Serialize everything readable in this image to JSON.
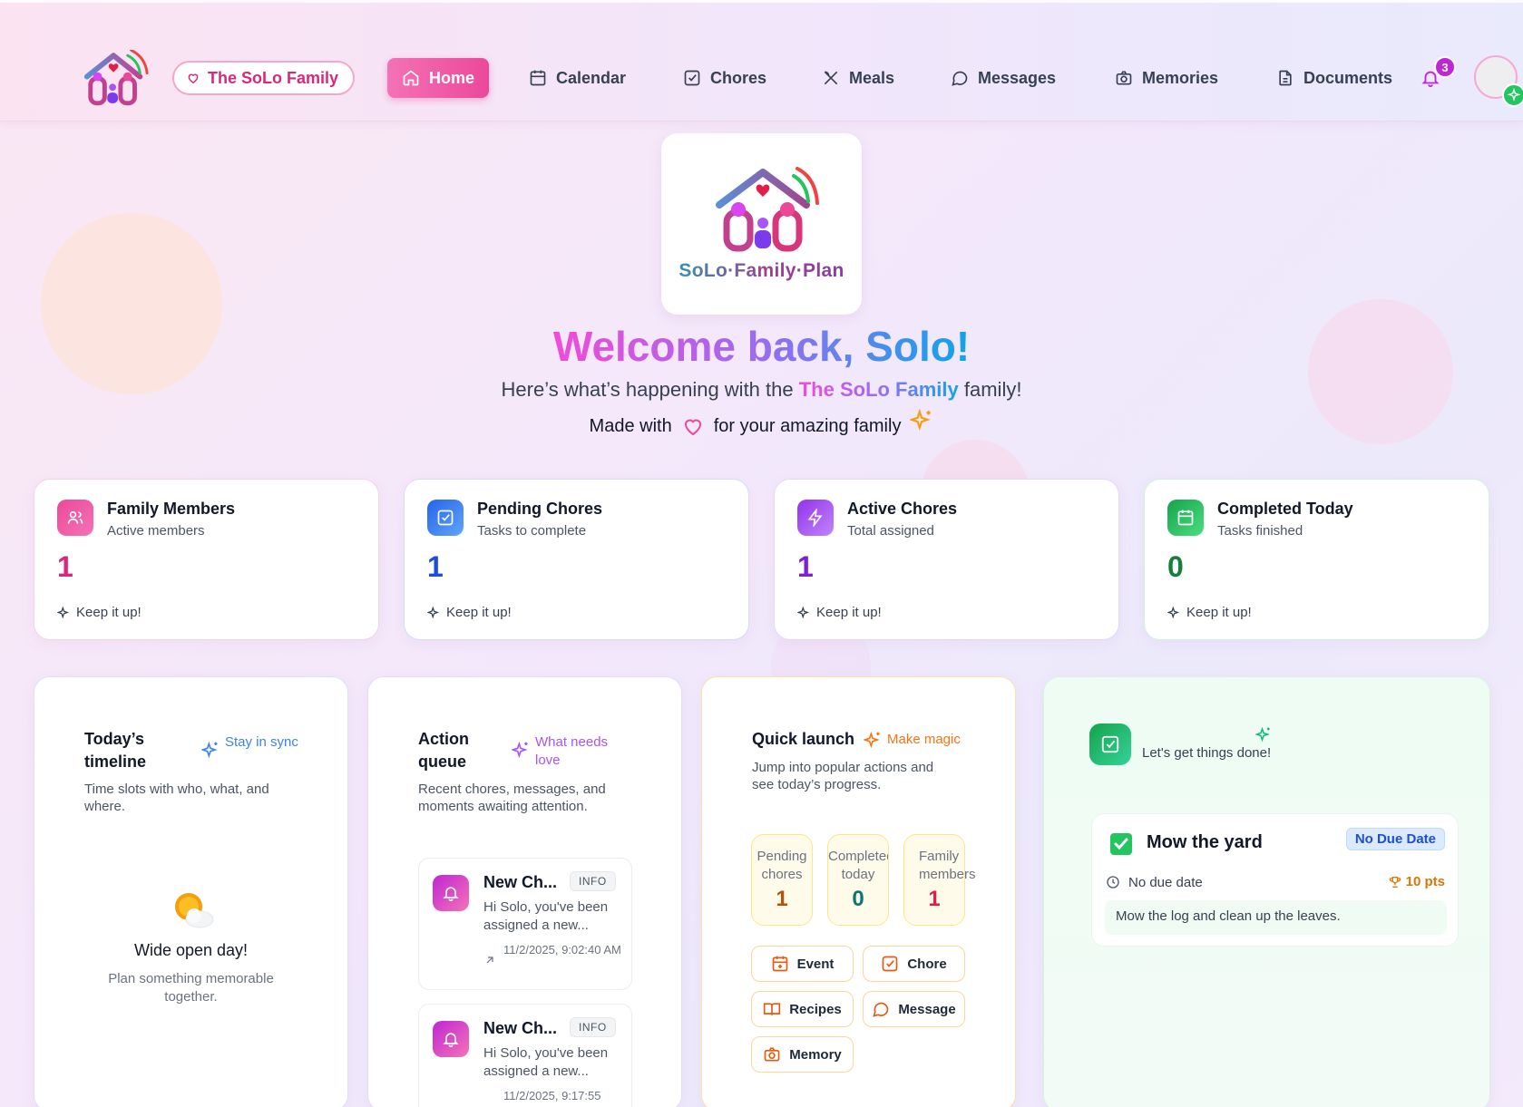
{
  "header": {
    "family_pill": "The SoLo Family",
    "nav": [
      {
        "label": "Home",
        "icon": "home-icon"
      },
      {
        "label": "Calendar",
        "icon": "calendar-icon"
      },
      {
        "label": "Chores",
        "icon": "check-square-icon"
      },
      {
        "label": "Meals",
        "icon": "utensils-icon"
      },
      {
        "label": "Messages",
        "icon": "message-circle-icon"
      },
      {
        "label": "Memories",
        "icon": "camera-icon"
      },
      {
        "label": "Documents",
        "icon": "file-text-icon"
      }
    ],
    "notification_count": "3"
  },
  "hero": {
    "logo_text": "SoLo·Family·Plan",
    "welcome": "Welcome back, Solo!",
    "subtitle_prefix": "Here’s what’s happening with the ",
    "subtitle_family": "The SoLo Family",
    "subtitle_suffix": " family!",
    "made_with_prefix": "Made with",
    "made_with_suffix": "for your amazing family"
  },
  "stats": [
    {
      "title": "Family Members",
      "subtitle": "Active members",
      "value": "1",
      "footer": "Keep it up!",
      "color": "#db2777"
    },
    {
      "title": "Pending Chores",
      "subtitle": "Tasks to complete",
      "value": "1",
      "footer": "Keep it up!",
      "color": "#1d4ed8"
    },
    {
      "title": "Active Chores",
      "subtitle": "Total assigned",
      "value": "1",
      "footer": "Keep it up!",
      "color": "#7e22ce"
    },
    {
      "title": "Completed Today",
      "subtitle": "Tasks finished",
      "value": "0",
      "footer": "Keep it up!",
      "color": "#15803d"
    }
  ],
  "timeline": {
    "title": "Today’s timeline",
    "tag": "Stay in sync",
    "desc": "Time slots with who, what, and where.",
    "empty_title": "Wide open day!",
    "empty_desc": "Plan something memorable together."
  },
  "action_queue": {
    "title": "Action queue",
    "tag": "What needs love",
    "desc": "Recent chores, messages, and moments awaiting attention.",
    "items": [
      {
        "title": "New Ch...",
        "badge": "INFO",
        "body": "Hi Solo, you've been assigned a new...",
        "time": "11/2/2025, 9:02:40 AM"
      },
      {
        "title": "New Ch...",
        "badge": "INFO",
        "body": "Hi Solo, you've been assigned a new...",
        "time": "11/2/2025, 9:17:55"
      }
    ]
  },
  "quick_launch": {
    "title": "Quick launch",
    "tag": "Make magic",
    "desc": "Jump into popular actions and see today’s progress.",
    "mini_stats": [
      {
        "label_1": "Pending",
        "label_2": "chores",
        "value": "1"
      },
      {
        "label_1": "Completed",
        "label_2": "today",
        "value": "0"
      },
      {
        "label_1": "Family",
        "label_2": "members",
        "value": "1"
      }
    ],
    "buttons": [
      {
        "label": "Event",
        "icon": "calendar-plus-icon"
      },
      {
        "label": "Chore",
        "icon": "check-square-icon"
      },
      {
        "label": "Recipes",
        "icon": "book-open-icon"
      },
      {
        "label": "Message",
        "icon": "message-circle-icon"
      },
      {
        "label": "Memory",
        "icon": "camera-icon"
      }
    ]
  },
  "chores_card": {
    "tagline": "Let's get things done!",
    "item": {
      "title": "Mow the yard",
      "due_badge": "No Due Date",
      "due_text": "No due date",
      "points": "10 pts",
      "description": "Mow the log and clean up the leaves."
    }
  }
}
